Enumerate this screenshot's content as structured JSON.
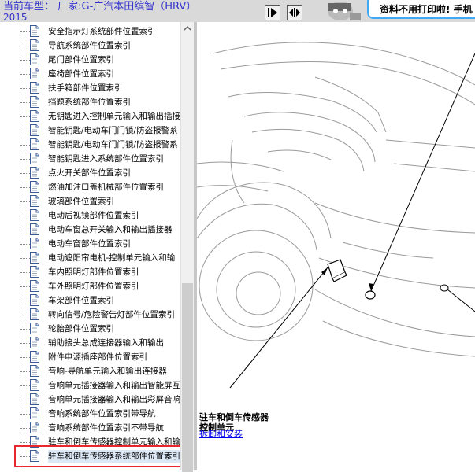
{
  "header": {
    "car_label": "当前车型：  厂家:G-广汽本田缤智（HRV）",
    "car_year": "2015",
    "banner_text": "资料不用打印啦! 手机"
  },
  "tree": {
    "items": [
      {
        "label": "安全指示灯系统部件位置索引"
      },
      {
        "label": "导航系统部件位置索引"
      },
      {
        "label": "尾门部件位置索引"
      },
      {
        "label": "座椅部件位置索引"
      },
      {
        "label": "扶手箱部件位置索引"
      },
      {
        "label": "挡题系统部件位置索引"
      },
      {
        "label": "无钥匙进入控制单元输入和输出插接"
      },
      {
        "label": "智能钥匙/电动车门门锁/防盗报警系"
      },
      {
        "label": "智能钥匙/电动车门门锁/防盗报警系"
      },
      {
        "label": "智能钥匙进入系统部件位置索引"
      },
      {
        "label": "点火开关部件位置索引"
      },
      {
        "label": "燃油加注口盖机械部件位置索引"
      },
      {
        "label": "玻璃部件位置索引"
      },
      {
        "label": "电动后视镜部件位置索引"
      },
      {
        "label": "电动车窗总开关输入和输出插接器"
      },
      {
        "label": "电动车窗部件位置索引"
      },
      {
        "label": "电动遮阳帘电机-控制单元输入和输"
      },
      {
        "label": "车内照明灯部件位置索引"
      },
      {
        "label": "车外照明灯部件位置索引"
      },
      {
        "label": "车架部件位置索引"
      },
      {
        "label": "转向信号/危险警告灯部件位置索引"
      },
      {
        "label": "轮胎部件位置索引"
      },
      {
        "label": "辅助接头总成连接器输入和输出"
      },
      {
        "label": "附件电源插座部件位置索引"
      },
      {
        "label": "音响-导航单元输入和输出连接器"
      },
      {
        "label": "音响单元插接器输入和输出智能屏互"
      },
      {
        "label": "音响单元插接器输入和输出彩屏音响"
      },
      {
        "label": "音响系统部件位置索引带导航"
      },
      {
        "label": "音响系统部件位置索引不带导航"
      },
      {
        "label": "驻车和倒车传感器控制单元输入和输"
      },
      {
        "label": "驻车和倒车传感器系统部件位置索引"
      }
    ]
  },
  "diagram": {
    "callout_line1": "驻车和倒车传感器",
    "callout_line2": "控制单元",
    "link_text": "拆卸和安装"
  },
  "colors": {
    "header_text": "#3333cc",
    "highlight_border": "#e8262d",
    "banner_border": "#3fa9f5",
    "link": "#0000ee"
  }
}
